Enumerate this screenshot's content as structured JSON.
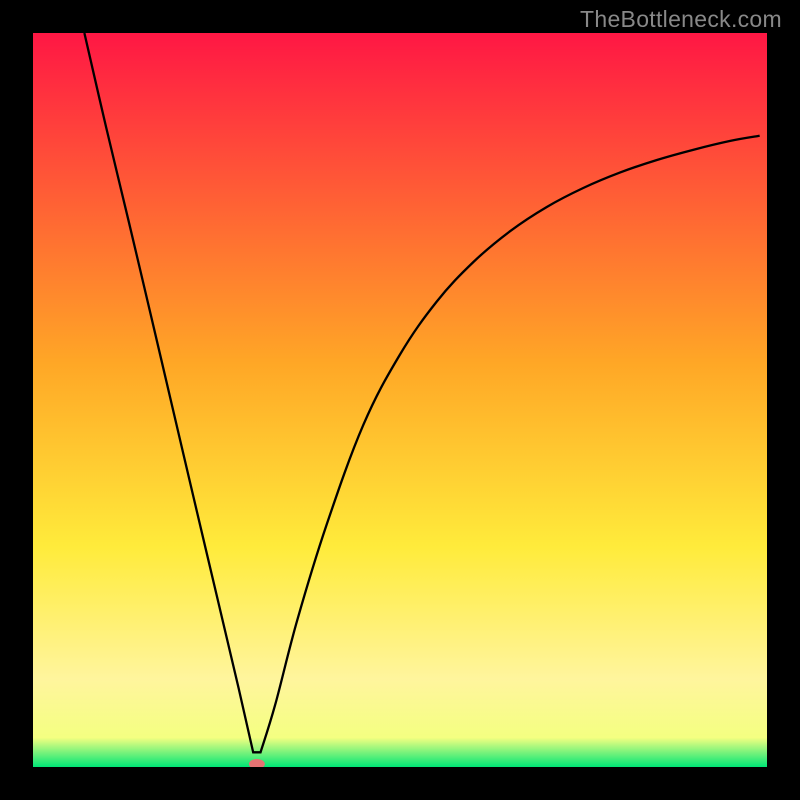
{
  "watermark": "TheBottleneck.com",
  "chart_data": {
    "type": "line",
    "title": "",
    "xlabel": "",
    "ylabel": "",
    "xlim": [
      0,
      100
    ],
    "ylim": [
      0,
      100
    ],
    "grid": false,
    "background_gradient": [
      {
        "offset": 0,
        "color": "#ff1744"
      },
      {
        "offset": 0.45,
        "color": "#ffa726"
      },
      {
        "offset": 0.7,
        "color": "#ffeb3b"
      },
      {
        "offset": 0.88,
        "color": "#fff59d"
      },
      {
        "offset": 0.96,
        "color": "#f4ff81"
      },
      {
        "offset": 1.0,
        "color": "#00e676"
      }
    ],
    "minimum_marker": {
      "x": 30.5,
      "y": 0,
      "color": "#e57373"
    },
    "series": [
      {
        "name": "bottleneck-curve",
        "color": "#000000",
        "x": [
          7,
          10,
          13,
          16,
          19,
          22,
          25,
          28,
          30,
          31,
          33,
          36,
          40,
          45,
          50,
          55,
          60,
          65,
          70,
          75,
          80,
          85,
          90,
          95,
          99
        ],
        "y": [
          100,
          87,
          74.5,
          61.8,
          49,
          36.2,
          23.5,
          10.8,
          2,
          2,
          8.5,
          20,
          33,
          46.6,
          56.2,
          63.4,
          68.8,
          73,
          76.3,
          78.9,
          81,
          82.7,
          84.1,
          85.3,
          86
        ]
      }
    ]
  }
}
